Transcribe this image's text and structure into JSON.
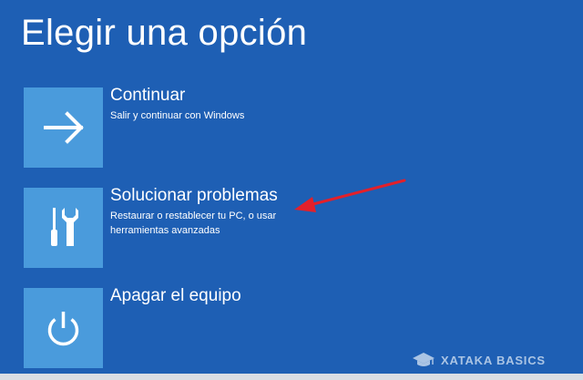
{
  "title": "Elegir una opción",
  "options": [
    {
      "title": "Continuar",
      "description": "Salir y continuar con Windows",
      "icon": "arrow-right-icon"
    },
    {
      "title": "Solucionar problemas",
      "description": "Restaurar o restablecer tu PC, o usar herramientas avanzadas",
      "icon": "tools-icon"
    },
    {
      "title": "Apagar el equipo",
      "description": "",
      "icon": "power-icon"
    }
  ],
  "annotation": {
    "icon": "red-arrow-icon",
    "color": "#e3202a"
  },
  "watermark": {
    "text": "XATAKA BASICS",
    "icon": "graduation-cap-icon"
  },
  "colors": {
    "background": "#1e5fb4",
    "tile": "#4a9bdc",
    "text": "#ffffff"
  }
}
